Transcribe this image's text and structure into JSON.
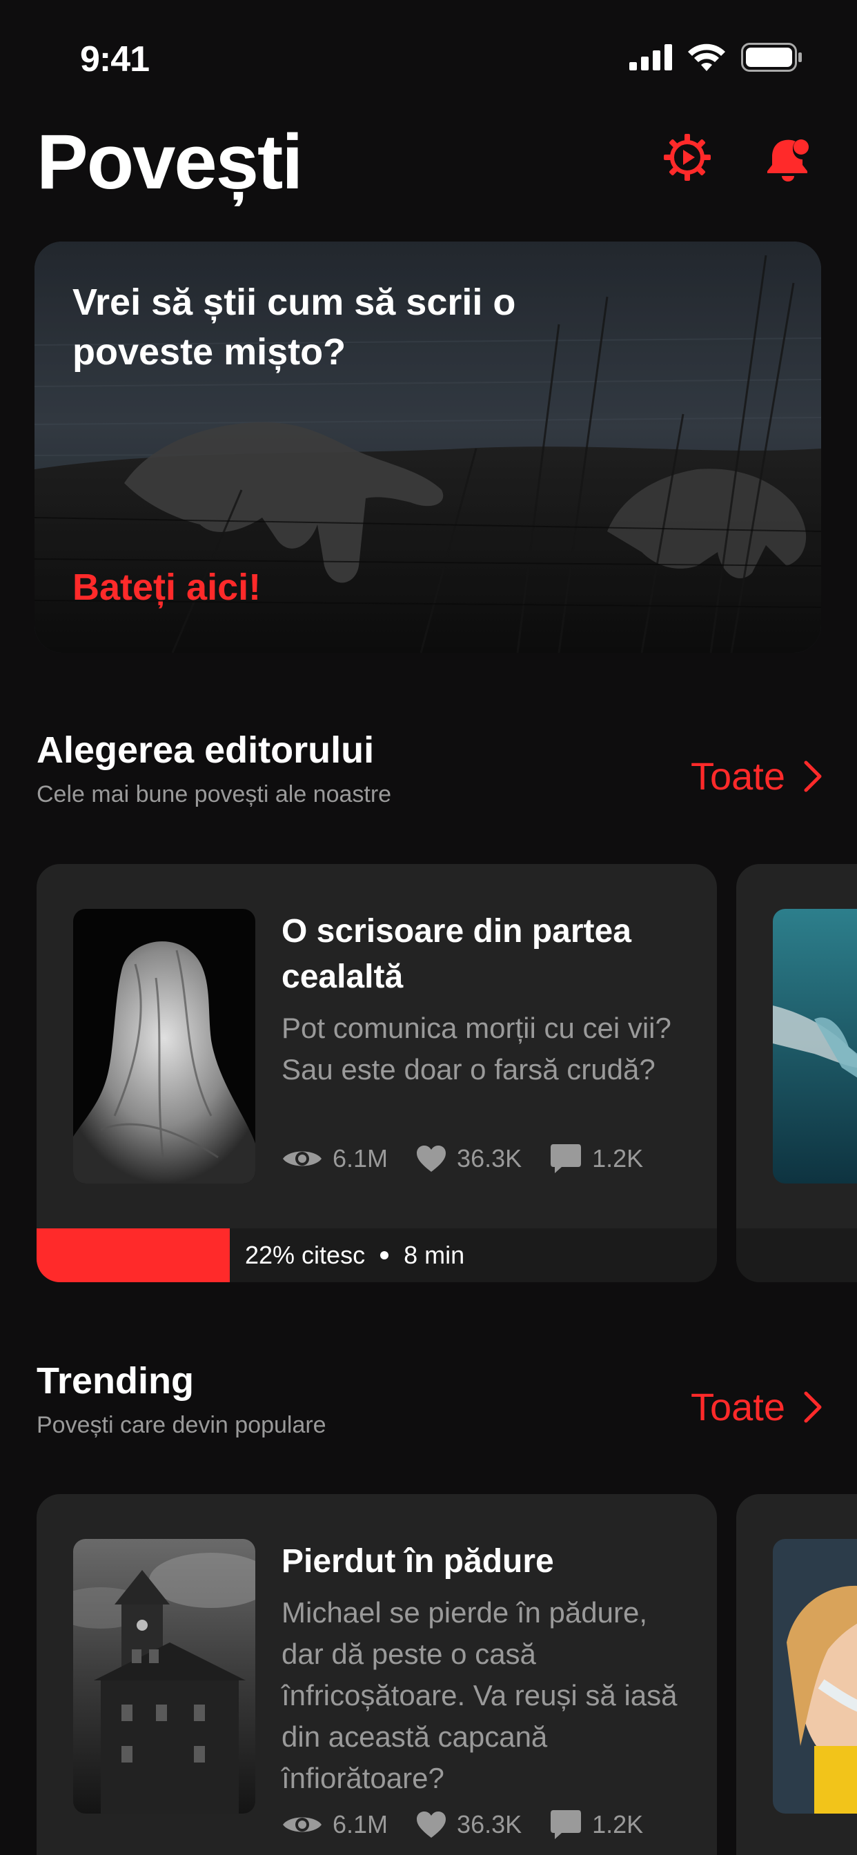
{
  "status": {
    "time": "9:41"
  },
  "header": {
    "title": "Povești"
  },
  "hero": {
    "heading": "Vrei să știi cum să scrii o poveste mișto?",
    "link": "Bateți aici!"
  },
  "sections": [
    {
      "title": "Alegerea editorului",
      "subtitle": "Cele mai bune povești ale noastre",
      "see_all": "Toate",
      "card": {
        "title": "O scrisoare din partea cealaltă",
        "description": "Pot comunica morții cu cei vii? Sau este doar o farsă crudă?",
        "views": "6.1M",
        "likes": "36.3K",
        "comments": "1.2K",
        "progress_percent": 22,
        "progress_label": "22% citesc",
        "duration": "8 min"
      }
    },
    {
      "title": "Trending",
      "subtitle": "Povești care devin populare",
      "see_all": "Toate",
      "card": {
        "title": "Pierdut în pădure",
        "description": "Michael se pierde în pădure, dar dă peste o casă înfricoșătoare. Va reuși să iasă din această capcană înfiorătoare?",
        "views": "6.1M",
        "likes": "36.3K",
        "comments": "1.2K"
      }
    }
  ],
  "icons": {
    "settings": "gear-icon",
    "notifications": "bell-icon",
    "chevron": "chevron-right-icon",
    "views": "eye-icon",
    "likes": "heart-icon",
    "comments": "comment-icon"
  },
  "colors": {
    "background": "#0e0d0e",
    "card": "#232323",
    "accent": "#ff2a2a",
    "muted_text": "#9a9a9a"
  }
}
